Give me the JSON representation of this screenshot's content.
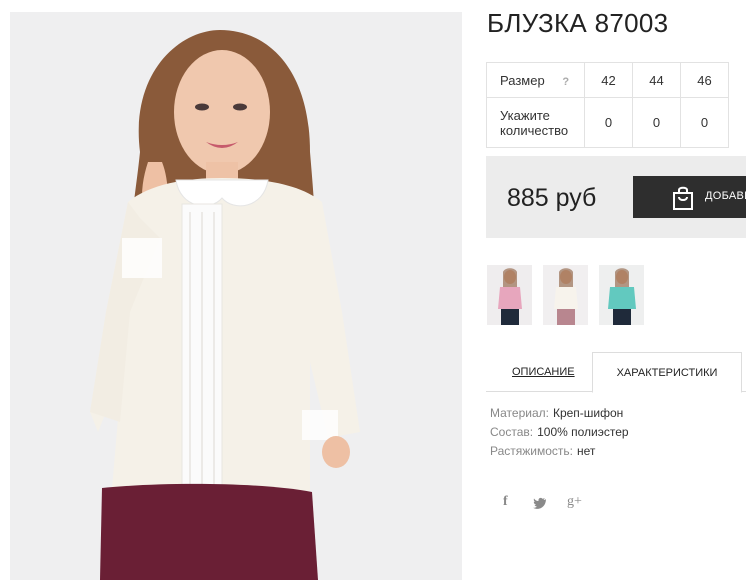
{
  "product": {
    "title": "БЛУЗКА 87003",
    "price": "885 руб"
  },
  "size_table": {
    "size_label": "Размер",
    "help_mark": "?",
    "sizes": [
      "42",
      "44",
      "46"
    ],
    "quantity_label": "Укажите количество",
    "quantities": [
      "0",
      "0",
      "0"
    ]
  },
  "cart": {
    "add_label": "ДОБАВИТЬ"
  },
  "thumbnails": [
    {
      "name": "thumb-pink",
      "color": "#e7a6bd"
    },
    {
      "name": "thumb-cream",
      "color": "#f5eee6"
    },
    {
      "name": "thumb-mint",
      "color": "#62c9bf"
    }
  ],
  "tabs": {
    "description": "ОПИСАНИЕ",
    "characteristics": "ХАРАКТЕРИСТИКИ"
  },
  "characteristics": [
    {
      "key": "Материал:",
      "value": "Креп-шифон"
    },
    {
      "key": "Состав:",
      "value": "100% полиэстер"
    },
    {
      "key": "Растяжимость:",
      "value": "нет"
    }
  ],
  "social": {
    "facebook": "f",
    "twitter": "twitter-icon",
    "google_plus": "g+"
  },
  "colors": {
    "blouse": "#f5f1e8",
    "trousers": "#6a1f35",
    "button_bg": "#2e2e2e",
    "price_bg": "#ececec"
  }
}
